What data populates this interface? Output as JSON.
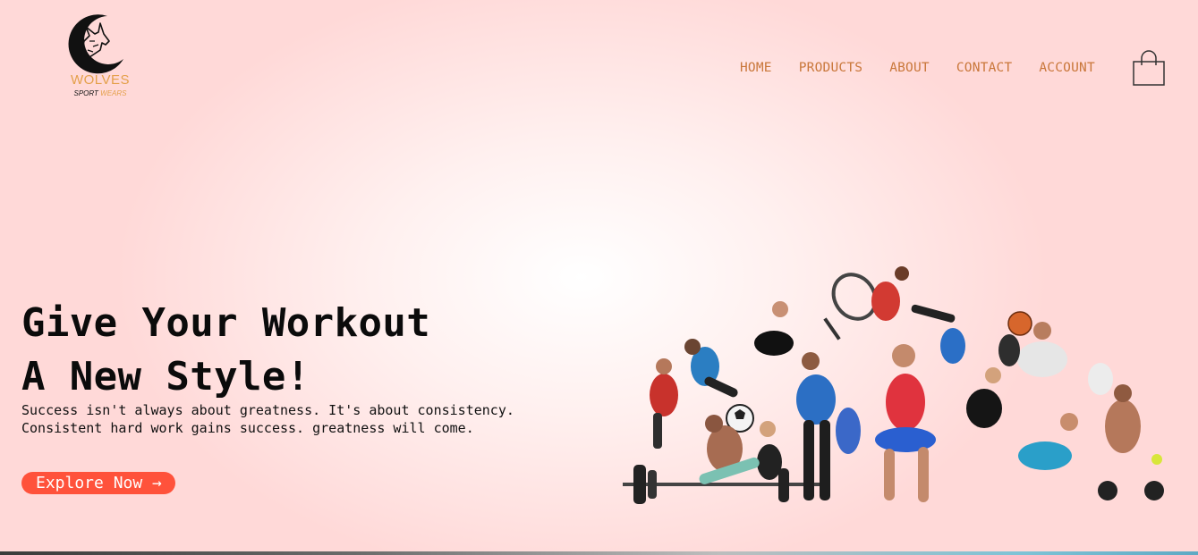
{
  "brand": {
    "name": "WOLVES",
    "tagline_part1": "SPORT",
    "tagline_part2": "WEARS",
    "accent_color": "#e4a04a",
    "logo_icon": "wolf-crescent-moon-icon"
  },
  "nav": {
    "items": [
      {
        "label": "HOME"
      },
      {
        "label": "PRODUCTS"
      },
      {
        "label": "ABOUT"
      },
      {
        "label": "CONTACT"
      },
      {
        "label": "ACCOUNT"
      }
    ],
    "link_color": "#c9773a",
    "cart_icon": "shopping-bag-icon"
  },
  "hero": {
    "title_line1": "Give Your Workout",
    "title_line2": "A New Style!",
    "text_line1": "Success isn't always about greatness. It's about consistency.",
    "text_line2": "Consistent hard work gains success. greatness will come.",
    "cta_label": "Explore Now →",
    "cta_color": "#ff523b",
    "image": "athletes-collage-image"
  }
}
